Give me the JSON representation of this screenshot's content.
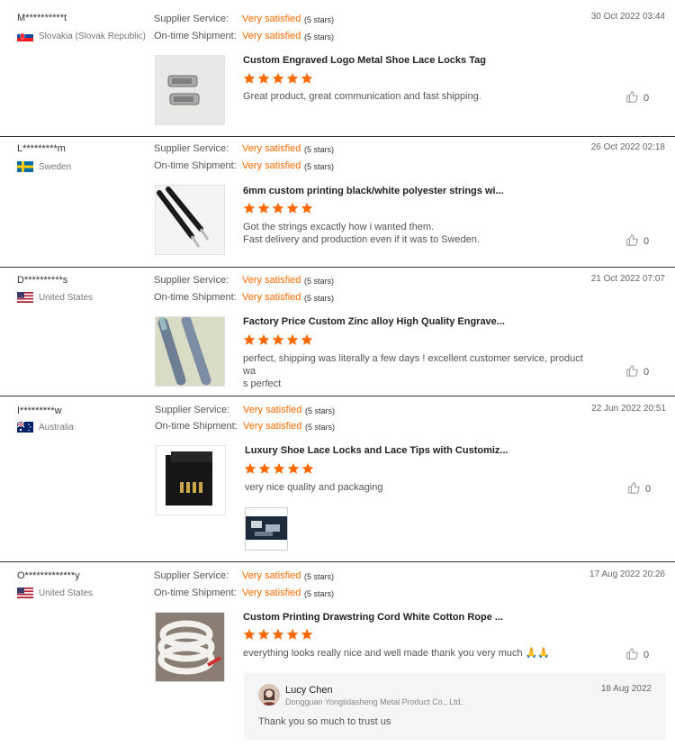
{
  "labels": {
    "supplier_service": "Supplier Service:",
    "ontime_shipment": "On-time Shipment:",
    "rating_word": "Very satisfied",
    "rating_stars": "(5 stars)"
  },
  "colors": {
    "accent": "#ff6a00",
    "divider": "#333333"
  },
  "reviews": [
    {
      "user": "M**********t",
      "country": "Slovakia (Slovak Republic)",
      "flag": "slovakia-flag",
      "date": "30 Oct 2022 03:44",
      "product": "Custom Engraved Logo Metal Shoe Lace Locks Tag",
      "rating": 5,
      "text": [
        "Great product, great communication and fast shipping."
      ],
      "likes": "0"
    },
    {
      "user": "L*********m",
      "country": "Sweden",
      "flag": "sweden-flag",
      "date": "26 Oct 2022 02:18",
      "product": "6mm custom printing black/white polyester strings wi...",
      "rating": 5,
      "text": [
        "Got the strings excactly how i wanted them.",
        "Fast delivery and production even if it was to Sweden."
      ],
      "likes": "0"
    },
    {
      "user": "D**********s",
      "country": "United States",
      "flag": "usa-flag",
      "date": "21 Oct 2022 07:07",
      "product": "Factory Price Custom Zinc alloy High Quality Engrave...",
      "rating": 5,
      "text": [
        "perfect, shipping was literally a few days ! excellent customer service, product wa",
        "s perfect"
      ],
      "likes": "0"
    },
    {
      "user": "I*********w",
      "country": "Australia",
      "flag": "australia-flag",
      "date": "22 Jun 2022 20:51",
      "product": "Luxury Shoe Lace Locks and Lace Tips with Customiz...",
      "rating": 5,
      "text": [
        "very nice quality and packaging"
      ],
      "likes": "0"
    },
    {
      "user": "O*************y",
      "country": "United States",
      "flag": "usa-flag",
      "date": "17 Aug 2022 20:26",
      "product": "Custom Printing Drawstring Cord White Cotton Rope ...",
      "rating": 5,
      "text": [
        "everything looks really nice and well made thank you very much 🙏🙏"
      ],
      "likes": "0"
    }
  ],
  "reply": {
    "name": "Lucy Chen",
    "company": "Dongguan Yonglidasheng Metal Product Co., Ltd.",
    "date": "18 Aug 2022",
    "text": "Thank you so much to trust us"
  }
}
